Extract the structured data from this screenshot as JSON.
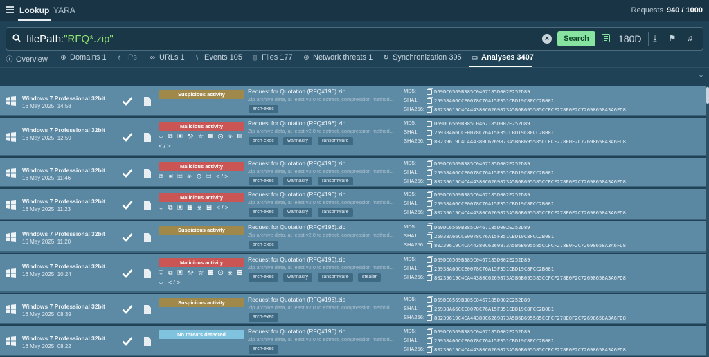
{
  "topbar": {
    "tabs": [
      "Lookup",
      "YARA"
    ],
    "requests_label": "Requests",
    "requests_value": "940 / 1000"
  },
  "search": {
    "key": "filePath:",
    "value": "\"RFQ*.zip\"",
    "button_label": "Search",
    "period": "180D"
  },
  "nav": {
    "tabs": [
      {
        "label": "Overview",
        "icon": "info-icon"
      },
      {
        "label": "Domains 1",
        "icon": "globe-icon"
      },
      {
        "label": "IPs",
        "icon": "pin-icon"
      },
      {
        "label": "URLs 1",
        "icon": "link-icon"
      },
      {
        "label": "Events 105",
        "icon": "events-icon"
      },
      {
        "label": "Files 177",
        "icon": "file-icon"
      },
      {
        "label": "Network threats 1",
        "icon": "network-icon"
      },
      {
        "label": "Synchronization 395",
        "icon": "sync-icon"
      },
      {
        "label": "Analyses 3407",
        "icon": "analyses-icon"
      }
    ]
  },
  "hash_labels": {
    "md5": "MD5:",
    "sha1": "SHA1:",
    "sha256": "SHA256:"
  },
  "rows": [
    {
      "os": "Windows 7 Professional 32bit",
      "date": "16 May 2025, 14:58",
      "verdict": "Suspicious activity",
      "verdict_type": "suspicious",
      "icons": "",
      "filename": "Request for Quotation (RFQ#196).zip",
      "desc": "Zip archive data, at least v2.0 to extract, compression method...",
      "tags": [
        "arch-exec"
      ],
      "md5": "D69DC6569B385C0467185D002E252D89",
      "sha1": "25938A66CCE0078C76A15F351CBD19C8FCC2B081",
      "sha256": "80239619C4CA44380C6269873A5B6B695585CCFCF278E0F2C72698658A3A6FD8"
    },
    {
      "os": "Windows 7 Professional 32bit",
      "date": "16 May 2025, 12:59",
      "verdict": "Malicious activity",
      "verdict_type": "malicious",
      "icons": "⛉ ⧉ ▣ ⚒ ⛥ ▦ ⚙ ☣ ▤ </>",
      "filename": "Request for Quotation (RFQ#196).zip",
      "desc": "Zip archive data, at least v2.0 to extract, compression method...",
      "tags": [
        "arch-exec",
        "wannacry",
        "ransomware"
      ],
      "md5": "D69DC6569B385C0467185D002E252D89",
      "sha1": "25938A66CCE0078C76A15F351CBD19C8FCC2B081",
      "sha256": "80239619C4CA44380C6269873A5B6B695585CCFCF278E0F2C72698658A3A6FD8"
    },
    {
      "os": "Windows 7 Professional 32bit",
      "date": "16 May 2025, 11:46",
      "verdict": "Malicious activity",
      "verdict_type": "malicious",
      "icons": "⧉ ▣ ▦ ☣ ⚙ ▤ </>",
      "filename": "Request for Quotation (RFQ#196).zip",
      "desc": "Zip archive data, at least v2.0 to extract, compression method...",
      "tags": [
        "arch-exec",
        "wannacry",
        "ransomware"
      ],
      "md5": "D69DC6569B385C0467185D002E252D89",
      "sha1": "25938A66CCE0078C76A15F351CBD19C8FCC2B081",
      "sha256": "80239619C4CA44380C6269873A5B6B695585CCFCF278E0F2C72698658A3A6FD8"
    },
    {
      "os": "Windows 7 Professional 32bit",
      "date": "16 May 2025, 11:23",
      "verdict": "Malicious activity",
      "verdict_type": "malicious",
      "icons": "⛉ ⧉ ▣ ▦ ☣ ▤ </>",
      "filename": "Request for Quotation (RFQ#196).zip",
      "desc": "Zip archive data, at least v2.0 to extract, compression method...",
      "tags": [
        "arch-exec",
        "wannacry",
        "ransomware"
      ],
      "md5": "D69DC6569B385C0467185D002E252D89",
      "sha1": "25938A66CCE0078C76A15F351CBD19C8FCC2B081",
      "sha256": "80239619C4CA44380C6269873A5B6B695585CCFCF278E0F2C72698658A3A6FD8"
    },
    {
      "os": "Windows 7 Professional 32bit",
      "date": "16 May 2025, 11:20",
      "verdict": "Suspicious activity",
      "verdict_type": "suspicious",
      "icons": "",
      "filename": "Request for Quotation (RFQ#196).zip",
      "desc": "Zip archive data, at least v2.0 to extract, compression method...",
      "tags": [
        "arch-exec"
      ],
      "md5": "D69DC6569B385C0467185D002E252D89",
      "sha1": "25938A66CCE0078C76A15F351CBD19C8FCC2B081",
      "sha256": "80239619C4CA44380C6269873A5B6B695585CCFCF278E0F2C72698658A3A6FD8"
    },
    {
      "os": "Windows 7 Professional 32bit",
      "date": "16 May 2025, 10:24",
      "verdict": "Malicious activity",
      "verdict_type": "malicious",
      "icons": "⛉ ⧉ ▣ ⚒ ⛥ ▦ ⚙ ☣ ▤ ⛉ </>",
      "filename": "Request for Quotation (RFQ#196).zip",
      "desc": "Zip archive data, at least v2.0 to extract, compression method...",
      "tags": [
        "arch-exec",
        "wannacry",
        "ransomware",
        "stealer"
      ],
      "md5": "D69DC6569B385C0467185D002E252D89",
      "sha1": "25938A66CCE0078C76A15F351CBD19C8FCC2B081",
      "sha256": "80239619C4CA44380C6269873A5B6B695585CCFCF278E0F2C72698658A3A6FD8"
    },
    {
      "os": "Windows 7 Professional 32bit",
      "date": "16 May 2025, 08:39",
      "verdict": "Suspicious activity",
      "verdict_type": "suspicious",
      "icons": "",
      "filename": "Request for Quotation (RFQ#196).zip",
      "desc": "Zip archive data, at least v2.0 to extract, compression method...",
      "tags": [
        "arch-exec"
      ],
      "md5": "D69DC6569B385C0467185D002E252D89",
      "sha1": "25938A66CCE0078C76A15F351CBD19C8FCC2B081",
      "sha256": "80239619C4CA44380C6269873A5B6B695585CCFCF278E0F2C72698658A3A6FD8"
    },
    {
      "os": "Windows 7 Professional 32bit",
      "date": "16 May 2025, 08:22",
      "verdict": "No threats detected",
      "verdict_type": "clean",
      "icons": "",
      "filename": "Request for Quotation (RFQ#196).zip",
      "desc": "Zip archive data, at least v2.0 to extract, compression method...",
      "tags": [
        "arch-exec"
      ],
      "md5": "D69DC6569B385C0467185D002E252D89",
      "sha1": "25938A66CCE0078C76A15F351CBD19C8FCC2B081",
      "sha256": "80239619C4CA44380C6269873A5B6B695585CCFCF278E0F2C72698658A3A6FD8"
    },
    {
      "os": "",
      "date": "",
      "verdict": "",
      "verdict_type": "clean",
      "icons": "",
      "filename": "Request for Quotation (RFQ#196).zip",
      "desc": "",
      "tags": [],
      "md5": "",
      "sha1": "",
      "sha256": ""
    }
  ]
}
